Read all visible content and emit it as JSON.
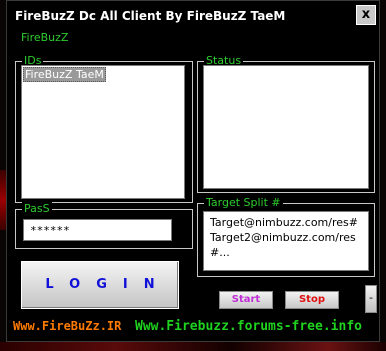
{
  "window": {
    "title": "FireBuzZ Dc All Client By FireBuzZ TaeM",
    "close_label": "x",
    "app_label": "FireBuzZ"
  },
  "ids": {
    "legend": "IDs",
    "items": [
      "FireBuzZ TaeM"
    ]
  },
  "status": {
    "legend": "Status"
  },
  "password": {
    "legend": "PasS",
    "value": "******"
  },
  "target": {
    "legend": "Target Split #",
    "value": "Target@nimbuzz.com/res#Target2@nimbuzz.com/res#..."
  },
  "buttons": {
    "login": "LOGIN",
    "start": "Start",
    "stop": "Stop",
    "minus": "-"
  },
  "links": {
    "site1": "Www.FireBuZz.IR",
    "site2": "Www.Firebuzz.forums-free.info"
  },
  "colors": {
    "legend_text": "#2ecc2e",
    "link_orange": "#ff7a00",
    "link_green": "#1fd21f",
    "login_text": "#1010d8",
    "start_text": "#c22bd8",
    "stop_text": "#e01010"
  }
}
